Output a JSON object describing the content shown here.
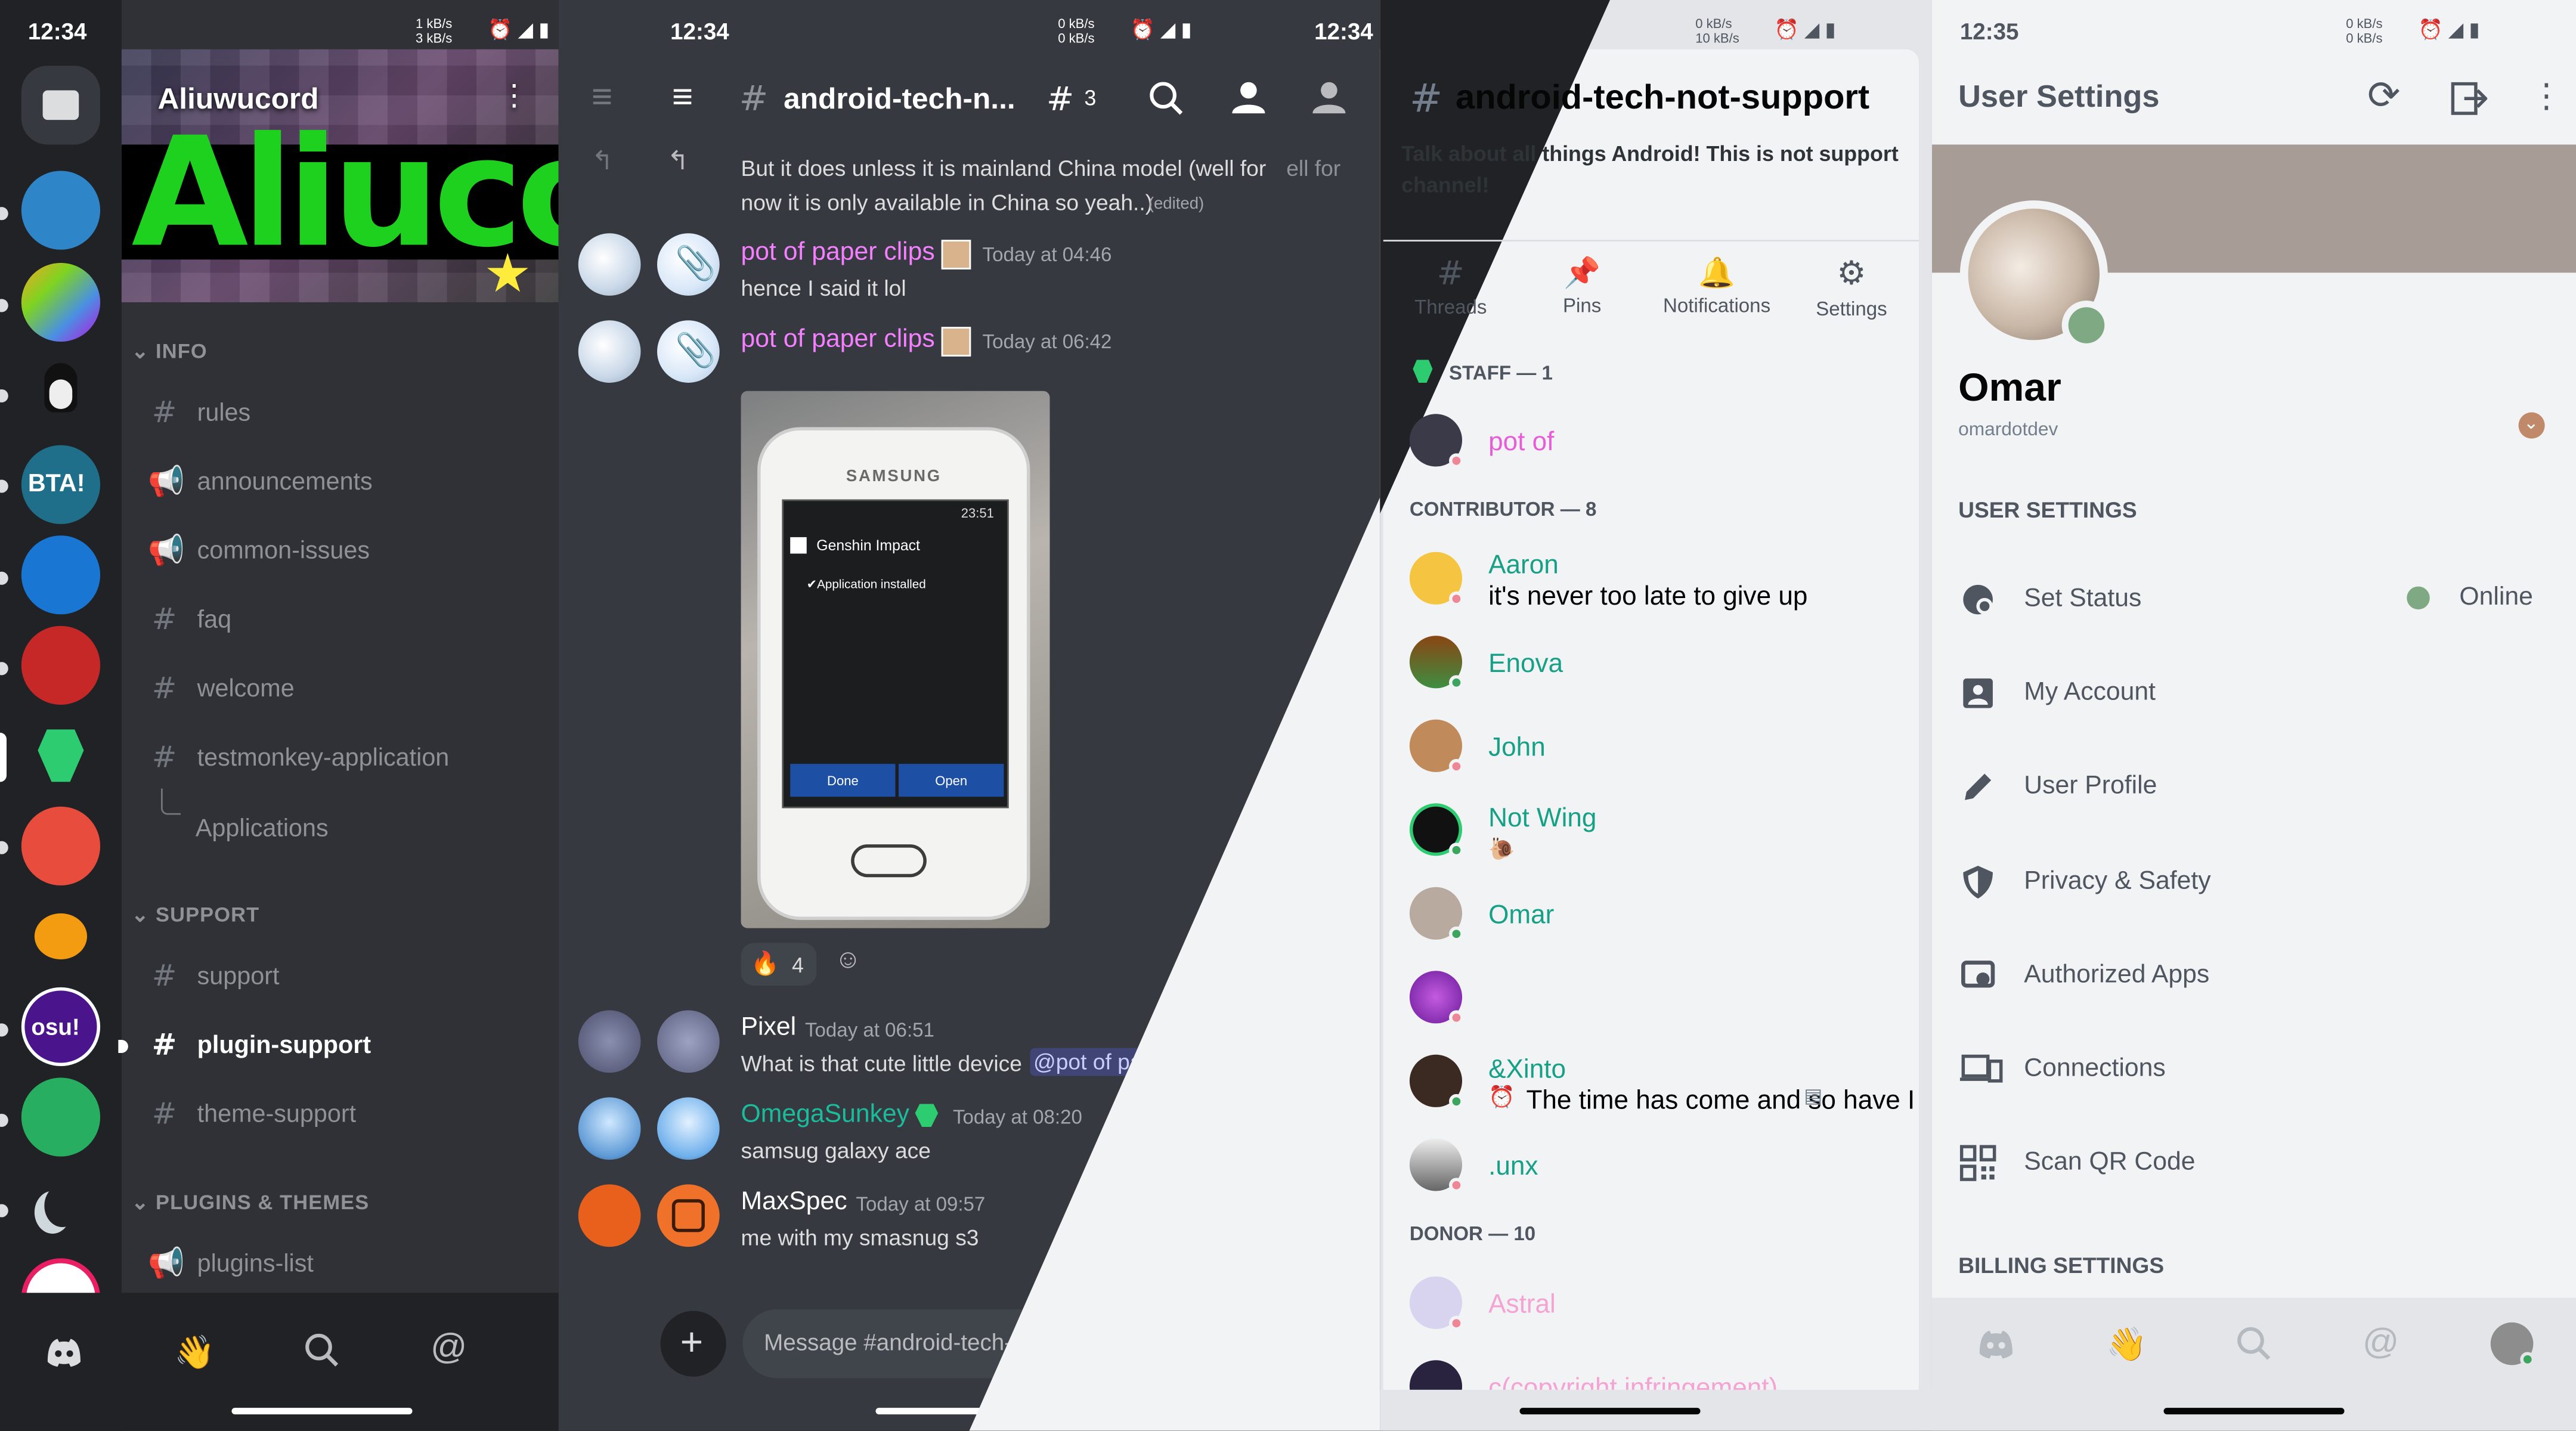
{
  "panels": {
    "server_list": {
      "status": {
        "time": "12:34",
        "net": "1 kB/s\n3 kB/s"
      },
      "server_name": "Aliuwucord",
      "banner_text": "Aliucord",
      "categories": [
        {
          "label": "INFO"
        },
        {
          "label": "SUPPORT"
        },
        {
          "label": "PLUGINS & THEMES"
        }
      ],
      "channels": {
        "rules": "rules",
        "announcements": "announcements",
        "common_issues": "common-issues",
        "faq": "faq",
        "welcome": "welcome",
        "testmonkey": "testmonkey-application",
        "applications": "Applications",
        "support": "support",
        "plugin_support": "plugin-support",
        "theme_support": "theme-support",
        "plugins_list": "plugins-list"
      }
    },
    "chat": {
      "status": {
        "time": "12:34",
        "net": "0 kB/s\n0 kB/s"
      },
      "channel": "android-tech-n...",
      "thread_count": "3",
      "messages": [
        {
          "body": "But it does unless it is mainland China model (well for",
          "body2": "now it is only available in China so yeah..)",
          "edited": "(edited)",
          "ghost": "ell for"
        },
        {
          "author": "pot of paper clips",
          "time": "Today at 04:46",
          "body": "hence I said it lol"
        },
        {
          "author": "pot of paper clips",
          "time": "Today at 06:42"
        },
        {
          "author": "Pixel",
          "time": "Today at 06:51",
          "body": "What is that cute little device ",
          "mention": "@pot of paper clips",
          "ghost": "s"
        },
        {
          "author": "OmegaSunkey",
          "time": "Today at 08:20",
          "body": "samsug galaxy ace"
        },
        {
          "author": "MaxSpec",
          "time": "Today at 09:57",
          "body": "me with my smasnug s3"
        }
      ],
      "phone": {
        "brand": "SAMSUNG",
        "clock": "23:51",
        "app": "Genshin Impact",
        "installed": "Application installed",
        "done": "Done",
        "open": "Open"
      },
      "reaction": {
        "emoji": "🔥",
        "count": "4"
      },
      "composer_placeholder": "Message #android-tech-not-support",
      "status_time_right": "12:34"
    },
    "channel_info": {
      "status": {
        "net": "0 kB/s\n10 kB/s"
      },
      "channel_title": "android-tech-not-support",
      "topic": "Talk about all things Android! This is not support channel!",
      "tabs": [
        {
          "label": "Threads",
          "icon": "threads-icon"
        },
        {
          "label": "Pins",
          "icon": "pin-icon"
        },
        {
          "label": "Notifications",
          "icon": "bell-icon"
        },
        {
          "label": "Settings",
          "icon": "gear-icon"
        }
      ],
      "groups": [
        {
          "label": "STAFF — 1"
        },
        {
          "label": "CONTRIBUTOR — 8"
        },
        {
          "label": "DONOR — 10"
        }
      ],
      "members": [
        {
          "name": "pot of"
        },
        {
          "name": "Aaron",
          "status": "it's never too late to give up"
        },
        {
          "name": "Enova"
        },
        {
          "name": "John"
        },
        {
          "name": "Not Wing",
          "status": "🐌"
        },
        {
          "name": "Omar"
        },
        {
          "name": ""
        },
        {
          "name": "&Xinto",
          "status": "The time has come and so have I"
        },
        {
          "name": ".unx"
        },
        {
          "name": "Astral"
        },
        {
          "name": "c(copyright infringement)"
        }
      ]
    },
    "user_settings": {
      "status": {
        "time": "12:35",
        "net": "0 kB/s\n0 kB/s"
      },
      "title": "User Settings",
      "username": "Omar",
      "handle": "omardotdev",
      "section_user": "USER SETTINGS",
      "section_billing": "BILLING SETTINGS",
      "items": [
        {
          "label": "Set Status",
          "value": "Online",
          "icon": "status-icon"
        },
        {
          "label": "My Account",
          "icon": "account-icon"
        },
        {
          "label": "User Profile",
          "icon": "pencil-icon"
        },
        {
          "label": "Privacy & Safety",
          "icon": "shield-icon"
        },
        {
          "label": "Authorized Apps",
          "icon": "apps-icon"
        },
        {
          "label": "Connections",
          "icon": "devices-icon"
        },
        {
          "label": "Scan QR Code",
          "icon": "qr-icon"
        }
      ]
    }
  },
  "colors": {
    "discord_dark": "#36393f",
    "online": "#3ba55d",
    "link": "#8ea1e1",
    "pink_name": "#f47fff",
    "green_name": "#1abc9c"
  }
}
